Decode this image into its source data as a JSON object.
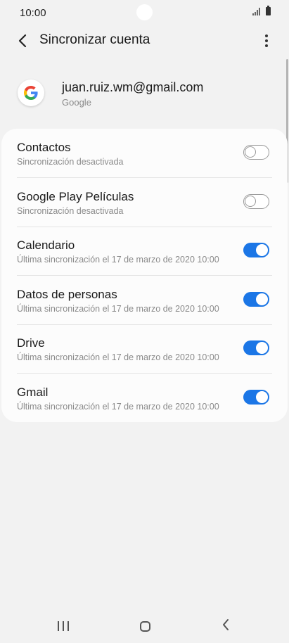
{
  "status_bar": {
    "time": "10:00"
  },
  "app_bar": {
    "title": "Sincronizar cuenta"
  },
  "account": {
    "email": "juan.ruiz.wm@gmail.com",
    "type": "Google"
  },
  "sync_items": [
    {
      "title": "Contactos",
      "subtitle": "Sincronización desactivada",
      "enabled": false
    },
    {
      "title": "Google Play Películas",
      "subtitle": "Sincronización desactivada",
      "enabled": false
    },
    {
      "title": "Calendario",
      "subtitle": "Última sincronización el 17 de marzo de 2020 10:00",
      "enabled": true
    },
    {
      "title": "Datos de personas",
      "subtitle": "Última sincronización el 17 de marzo de 2020 10:00",
      "enabled": true
    },
    {
      "title": "Drive",
      "subtitle": "Última sincronización el 17 de marzo de 2020 10:00",
      "enabled": true
    },
    {
      "title": "Gmail",
      "subtitle": "Última sincronización el 17 de marzo de 2020 10:00",
      "enabled": true
    }
  ],
  "colors": {
    "accent": "#1b76e6",
    "background": "#f2f2f2",
    "card": "#fcfcfc"
  },
  "icons": {
    "back": "back-arrow-icon",
    "more": "more-vert-icon",
    "account": "google-logo-icon",
    "nav_recents": "recents-icon",
    "nav_home": "home-icon",
    "nav_back": "nav-back-icon"
  }
}
